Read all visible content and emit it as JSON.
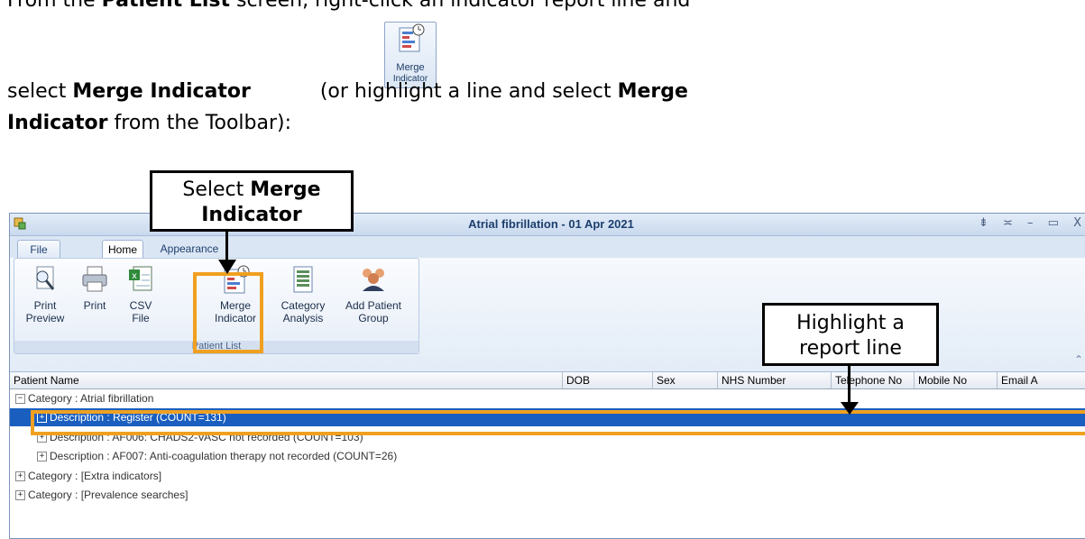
{
  "instructions": {
    "line1_pre": "From the ",
    "line1_bold": "Patient List",
    "line1_post": " screen, right-click an indicator report line and",
    "line2_pre": "select ",
    "line2_bold": "Merge Indicator",
    "line2_post": " (or highlight a line and select ",
    "line2_bold2": "Merge",
    "line3_bold": "Indicator",
    "line3_post": " from the Toolbar):",
    "icon_label_top": "Merge",
    "icon_label_bottom": "Indicator"
  },
  "window": {
    "title": "Atrial fibrillation - 01 Apr 2021",
    "controls": "⇟ ≍ – ▭ X"
  },
  "ribbon": {
    "tabs": [
      "File",
      "Home",
      "Appearance"
    ],
    "buttons": [
      {
        "line1": "Print",
        "line2": "Preview",
        "icon": "print-preview-icon"
      },
      {
        "line1": "Print",
        "line2": "",
        "icon": "print-icon"
      },
      {
        "line1": "CSV",
        "line2": "File",
        "icon": "csv-file-icon"
      },
      {
        "line1": "Merge",
        "line2": "Indicator",
        "icon": "merge-indicator-icon"
      },
      {
        "line1": "Category",
        "line2": "Analysis",
        "icon": "category-analysis-icon"
      },
      {
        "line1": "Add Patient",
        "line2": "Group",
        "icon": "add-patient-group-icon"
      }
    ],
    "group_label": "Patient List"
  },
  "grid": {
    "columns": [
      "Patient Name",
      "DOB",
      "Sex",
      "NHS Number",
      "Telephone No",
      "Mobile No",
      "Email A"
    ],
    "rows": [
      {
        "text": "Category : Atrial fibrillation",
        "expander": "−"
      },
      {
        "text": "Description : Register (COUNT=131)",
        "expander": "+"
      },
      {
        "text": "Description : AF006: CHADS2-VASC not recorded (COUNT=103)",
        "expander": "+"
      },
      {
        "text": "Description : AF007: Anti-coagulation therapy not recorded (COUNT=26)",
        "expander": "+"
      },
      {
        "text": "Category : [Extra indicators]",
        "expander": "+"
      },
      {
        "text": "Category : [Prevalence searches]",
        "expander": "+"
      }
    ]
  },
  "callouts": {
    "merge_line1_pre": "Select ",
    "merge_line1_bold": "Merge",
    "merge_line2_bold": "Indicator",
    "highlight_line1": "Highlight a",
    "highlight_line2": "report line"
  },
  "colors": {
    "highlight_border": "#f0a020",
    "selected_row": "#1a5fbf"
  }
}
